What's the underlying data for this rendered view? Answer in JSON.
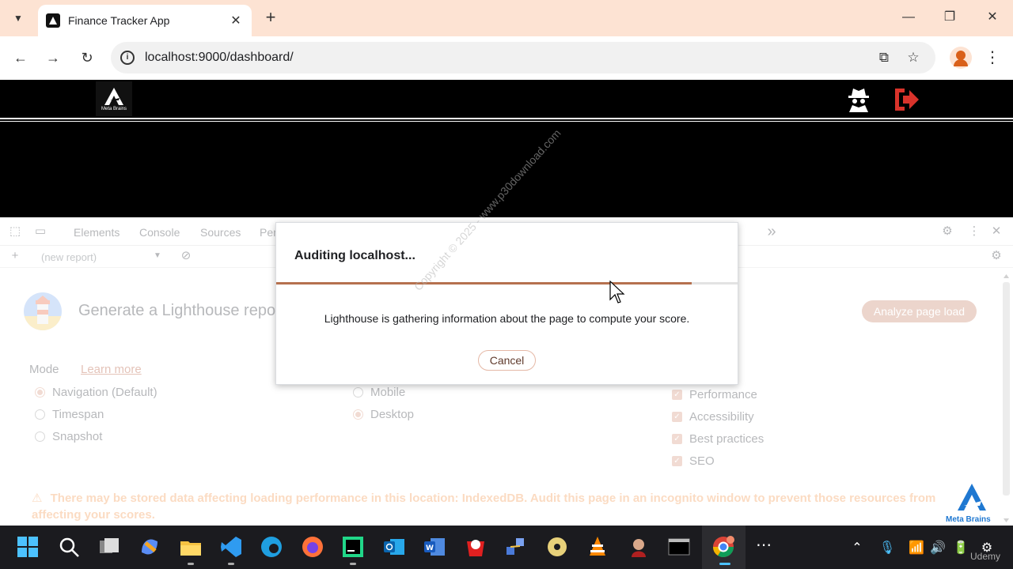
{
  "browser": {
    "tab_title": "Finance Tracker App",
    "url": "localhost:9000/dashboard/"
  },
  "app": {
    "logo_text": "Meta Brains"
  },
  "devtools": {
    "tabs": [
      "Elements",
      "Console",
      "Sources",
      "Per"
    ],
    "report_select": "(new report)",
    "lighthouse_heading": "Generate a Lighthouse repo",
    "analyze_label": "Analyze page load",
    "mode_label": "Mode",
    "learn_more": "Learn more",
    "mode_options": [
      {
        "label": "Navigation (Default)",
        "selected": true
      },
      {
        "label": "Timespan",
        "selected": false
      },
      {
        "label": "Snapshot",
        "selected": false
      }
    ],
    "device_options": [
      {
        "label": "Mobile",
        "selected": false
      },
      {
        "label": "Desktop",
        "selected": true
      }
    ],
    "categories": [
      {
        "label": "Performance",
        "checked": true
      },
      {
        "label": "Accessibility",
        "checked": true
      },
      {
        "label": "Best practices",
        "checked": true
      },
      {
        "label": "SEO",
        "checked": true
      }
    ],
    "warning_line1": "There may be stored data affecting loading performance in this location: IndexedDB. Audit this page in an incognito window to prevent those resources from",
    "warning_line2": "affecting your scores.",
    "watermark_text": "Meta Brains"
  },
  "dialog": {
    "title": "Auditing localhost...",
    "progress": 0.9,
    "message": "Lighthouse is gathering information about the page to compute your score.",
    "cancel_label": "Cancel",
    "watermark": "Copyright © 2025 - www.p30download.com"
  },
  "taskbar": {
    "watermark": "Udemy"
  },
  "colors": {
    "accent": "#b5714e",
    "tab_bar": "#fde3d3",
    "warning": "#f7b079",
    "logout_red": "#d9332b"
  }
}
